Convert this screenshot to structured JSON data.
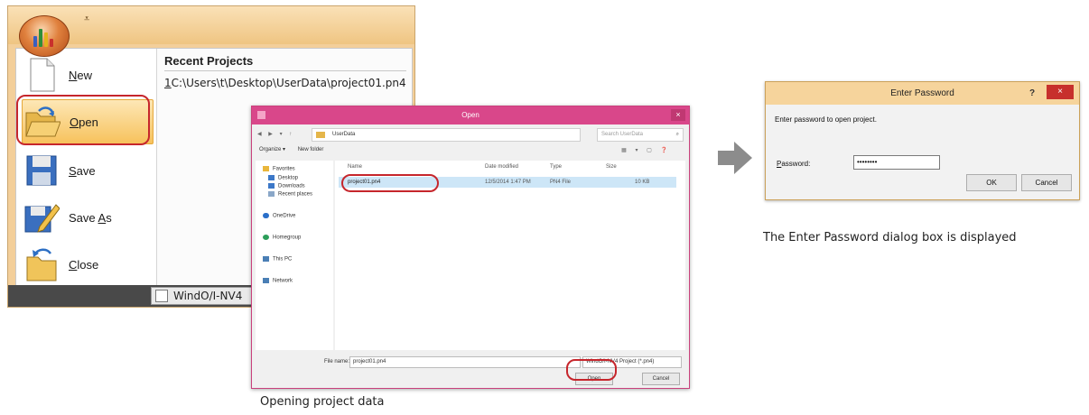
{
  "app_menu": {
    "qat_glyph": "⩡",
    "commands": [
      {
        "name": "new",
        "pre": "",
        "key": "N",
        "post": "ew"
      },
      {
        "name": "open",
        "pre": "",
        "key": "O",
        "post": "pen"
      },
      {
        "name": "save",
        "pre": "",
        "key": "S",
        "post": "ave"
      },
      {
        "name": "save-as",
        "pre": "Save ",
        "key": "A",
        "post": "s"
      },
      {
        "name": "close",
        "pre": "",
        "key": "C",
        "post": "lose"
      }
    ],
    "recent_header": "Recent Projects",
    "recent_items": [
      {
        "index": "1",
        "path": "C:\\Users\\t\\Desktop\\UserData\\project01.pn4"
      }
    ],
    "taskbar_label": "WindO/I-NV4"
  },
  "open_dialog": {
    "title": "Open",
    "address": "UserData",
    "search_placeholder": "Search UserData",
    "organize_label": "Organize ▾",
    "new_folder_label": "New folder",
    "nav_items": [
      {
        "label": "Favorites",
        "color": "#e9b63b"
      },
      {
        "label": "Desktop",
        "color": "#3c78c8"
      },
      {
        "label": "Downloads",
        "color": "#3c78c8"
      },
      {
        "label": "Recent places",
        "color": "#8aa7c8"
      },
      {
        "label": "OneDrive",
        "color": "#2a6fc9"
      },
      {
        "label": "Homegroup",
        "color": "#2c9e5a"
      },
      {
        "label": "This PC",
        "color": "#4a7fb5"
      },
      {
        "label": "Network",
        "color": "#4a7fb5"
      }
    ],
    "columns": [
      "Name",
      "Date modified",
      "Type",
      "Size"
    ],
    "files": [
      {
        "name": "project01.pn4",
        "date": "12/5/2014 1:47 PM",
        "type": "PN4 File",
        "size": "10 KB"
      }
    ],
    "file_name_label": "File name:",
    "file_name_value": "project01.pn4",
    "file_type_value": "WindO/I-NV4 Project (*.pn4)",
    "open_button": "Open",
    "cancel_button": "Cancel"
  },
  "password_dialog": {
    "title": "Enter Password",
    "help_glyph": "?",
    "close_glyph": "×",
    "message": "Enter password to open project.",
    "password_label_key": "P",
    "password_label_rest": "assword:",
    "password_value": "••••••••",
    "ok_button": "OK",
    "cancel_button": "Cancel"
  },
  "captions": {
    "opening": "Opening project data",
    "displayed": "The Enter Password dialog box is displayed"
  },
  "colors": {
    "highlight_ring": "#c6262c",
    "open_dialog_titlebar": "#d9478a",
    "password_titlebar": "#f6d49c",
    "arrow": "#8c8c8c"
  }
}
